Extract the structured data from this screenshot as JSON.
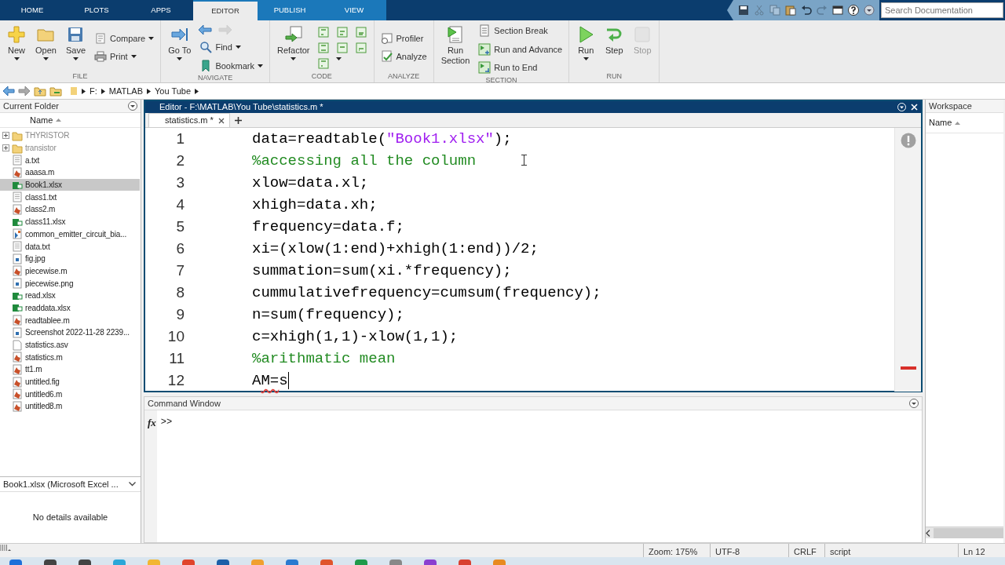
{
  "tabs": [
    {
      "label": "HOME",
      "selected": false,
      "contextual": false
    },
    {
      "label": "PLOTS",
      "selected": false,
      "contextual": false
    },
    {
      "label": "APPS",
      "selected": false,
      "contextual": false
    },
    {
      "label": "EDITOR",
      "selected": true,
      "contextual": false
    },
    {
      "label": "PUBLISH",
      "selected": false,
      "contextual": true
    },
    {
      "label": "VIEW",
      "selected": false,
      "contextual": true
    }
  ],
  "quick_access": [
    {
      "disabled": false
    },
    {
      "disabled": true
    },
    {
      "disabled": true
    },
    {
      "disabled": false
    },
    {
      "disabled": false
    },
    {
      "disabled": true
    },
    {
      "disabled": false
    },
    {
      "disabled": false
    },
    {
      "disabled": false
    }
  ],
  "search": {
    "placeholder": "Search Documentation"
  },
  "ribbon": [
    {
      "title": "FILE",
      "items": [
        {
          "kind": "large",
          "label": "New",
          "dropdown": true,
          "disabled": false
        },
        {
          "kind": "large",
          "label": "Open",
          "dropdown": true,
          "disabled": false
        },
        {
          "kind": "large",
          "label": "Save",
          "dropdown": true,
          "disabled": false
        },
        {
          "kind": "small",
          "label": "Compare",
          "dropdown": true,
          "disabled": false
        },
        {
          "kind": "small",
          "label": "Print",
          "dropdown": true,
          "disabled": false
        }
      ]
    },
    {
      "title": "NAVIGATE",
      "items": [
        {
          "kind": "large",
          "label": "Go To",
          "dropdown": true,
          "disabled": false
        },
        {
          "kind": "icon_row",
          "icons": [
            {
              "disabled": false
            },
            {
              "disabled": true
            }
          ]
        },
        {
          "kind": "small",
          "label": "Find",
          "dropdown": true,
          "disabled": false
        },
        {
          "kind": "small",
          "label": "Bookmark",
          "dropdown": true,
          "disabled": false
        }
      ]
    },
    {
      "title": "CODE",
      "items": [
        {
          "kind": "large",
          "label": "Refactor",
          "dropdown": true,
          "disabled": false
        },
        {
          "kind": "icon_grid"
        }
      ]
    },
    {
      "title": "ANALYZE",
      "items": [
        {
          "kind": "small",
          "label": "Profiler",
          "dropdown": false,
          "disabled": false
        },
        {
          "kind": "small",
          "label": "Analyze",
          "dropdown": false,
          "disabled": false
        }
      ]
    },
    {
      "title": "SECTION",
      "items": [
        {
          "kind": "large",
          "label": "Run\nSection",
          "dropdown": false,
          "disabled": false
        },
        {
          "kind": "small",
          "label": "Section Break",
          "dropdown": false,
          "disabled": false
        },
        {
          "kind": "small",
          "label": "Run and Advance",
          "dropdown": false,
          "disabled": false
        },
        {
          "kind": "small",
          "label": "Run to End",
          "dropdown": false,
          "disabled": false
        }
      ]
    },
    {
      "title": "RUN",
      "items": [
        {
          "kind": "large",
          "label": "Run",
          "dropdown": true,
          "disabled": false
        },
        {
          "kind": "large",
          "label": "Step",
          "dropdown": false,
          "disabled": false
        },
        {
          "kind": "large",
          "label": "Stop",
          "dropdown": false,
          "disabled": true
        }
      ]
    }
  ],
  "address": {
    "path": [
      "F:",
      "MATLAB",
      "You Tube"
    ]
  },
  "current_folder": {
    "title": "Current Folder",
    "column": "Name",
    "files": [
      {
        "name": "THYRISTOR",
        "kind": "folder",
        "expanded": false,
        "selected": false
      },
      {
        "name": "transistor",
        "kind": "folder",
        "expanded": false,
        "selected": false
      },
      {
        "name": "a.txt",
        "kind": "text",
        "selected": false
      },
      {
        "name": "aaasa.m",
        "kind": "script",
        "selected": false
      },
      {
        "name": "Book1.xlsx",
        "kind": "spreadsheet",
        "selected": true
      },
      {
        "name": "class1.txt",
        "kind": "text",
        "selected": false
      },
      {
        "name": "class2.m",
        "kind": "script",
        "selected": false
      },
      {
        "name": "class11.xlsx",
        "kind": "spreadsheet",
        "selected": false
      },
      {
        "name": "common_emitter_circuit_bia...",
        "kind": "model",
        "selected": false
      },
      {
        "name": "data.txt",
        "kind": "text",
        "selected": false
      },
      {
        "name": "fig.jpg",
        "kind": "image",
        "selected": false
      },
      {
        "name": "piecewise.m",
        "kind": "script",
        "selected": false
      },
      {
        "name": "piecewise.png",
        "kind": "image",
        "selected": false
      },
      {
        "name": "read.xlsx",
        "kind": "spreadsheet",
        "selected": false
      },
      {
        "name": "readdata.xlsx",
        "kind": "spreadsheet",
        "selected": false
      },
      {
        "name": "readtablee.m",
        "kind": "script",
        "selected": false
      },
      {
        "name": "Screenshot 2022-11-28 2239...",
        "kind": "image",
        "selected": false
      },
      {
        "name": "statistics.asv",
        "kind": "blank",
        "selected": false
      },
      {
        "name": "statistics.m",
        "kind": "script",
        "selected": false
      },
      {
        "name": "tt1.m",
        "kind": "script",
        "selected": false
      },
      {
        "name": "untitled.fig",
        "kind": "script",
        "selected": false
      },
      {
        "name": "untitled6.m",
        "kind": "script",
        "selected": false
      },
      {
        "name": "untitled8.m",
        "kind": "script",
        "selected": false
      }
    ]
  },
  "details": {
    "title": "Book1.xlsx  (Microsoft Excel ...",
    "message": "No details available"
  },
  "editor": {
    "title": "Editor - F:\\MATLAB\\You Tube\\statistics.m *",
    "tabs": [
      {
        "label": "statistics.m *",
        "selected": true
      }
    ],
    "lines": [
      {
        "number": "1",
        "cursor": false,
        "parts": [
          {
            "text": "data=readtable(",
            "kind": "plain"
          },
          {
            "text": "\"Book1.xlsx\"",
            "kind": "string"
          },
          {
            "text": ");",
            "kind": "plain"
          }
        ]
      },
      {
        "number": "2",
        "cursor": false,
        "parts": [
          {
            "text": "%accessing all the column",
            "kind": "comment"
          }
        ]
      },
      {
        "number": "3",
        "cursor": false,
        "parts": [
          {
            "text": "xlow=data.xl;",
            "kind": "plain"
          }
        ]
      },
      {
        "number": "4",
        "cursor": false,
        "parts": [
          {
            "text": "xhigh=data.xh;",
            "kind": "plain"
          }
        ]
      },
      {
        "number": "5",
        "cursor": false,
        "parts": [
          {
            "text": "frequency=data.f;",
            "kind": "plain"
          }
        ]
      },
      {
        "number": "6",
        "cursor": false,
        "parts": [
          {
            "text": "xi=(xlow(1:end)+xhigh(1:end))/2;",
            "kind": "plain"
          }
        ]
      },
      {
        "number": "7",
        "cursor": false,
        "parts": [
          {
            "text": "summation=sum(xi.*frequency);",
            "kind": "plain"
          }
        ]
      },
      {
        "number": "8",
        "cursor": false,
        "parts": [
          {
            "text": "cummulativefrequency=cumsum(frequency);",
            "kind": "plain"
          }
        ]
      },
      {
        "number": "9",
        "cursor": false,
        "parts": [
          {
            "text": "n=sum(frequency);",
            "kind": "plain"
          }
        ]
      },
      {
        "number": "10",
        "cursor": false,
        "parts": [
          {
            "text": "c=xhigh(1,1)-xlow(1,1);",
            "kind": "plain"
          }
        ]
      },
      {
        "number": "11",
        "cursor": false,
        "parts": [
          {
            "text": "%arithmatic mean",
            "kind": "comment"
          }
        ]
      },
      {
        "number": "12",
        "cursor": true,
        "parts": [
          {
            "text": "A",
            "kind": "plain"
          },
          {
            "text": "M=",
            "kind": "error"
          },
          {
            "text": "s",
            "kind": "plain"
          }
        ]
      }
    ]
  },
  "command_window": {
    "title": "Command Window",
    "function_browser": "fx",
    "prompt": ">>"
  },
  "workspace": {
    "title": "Workspace",
    "column": "Name"
  },
  "status_bar": {
    "items": [
      "Zoom: 175%",
      "UTF-8",
      "CRLF",
      "script",
      "Ln  12"
    ]
  }
}
